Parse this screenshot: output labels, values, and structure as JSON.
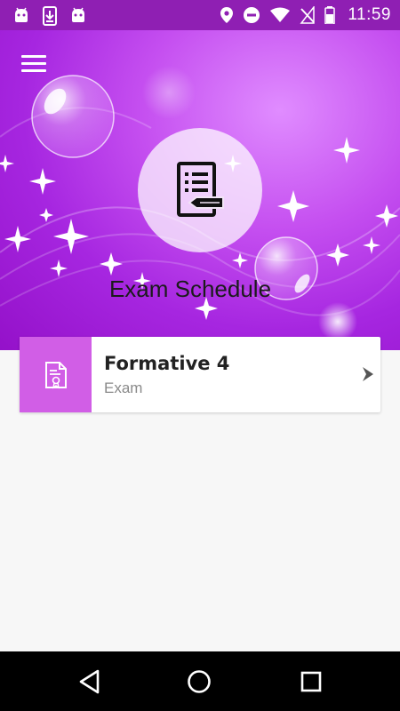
{
  "status_bar": {
    "time": "11:59",
    "left_icons": [
      "android-icon",
      "download-icon",
      "android-icon"
    ],
    "right_icons": [
      "location-icon",
      "do-not-disturb-icon",
      "wifi-icon",
      "no-sim-icon",
      "battery-icon"
    ]
  },
  "header": {
    "menu_icon": "hamburger-menu-icon",
    "logo_icon": "exam-document-icon",
    "title": "Exam Schedule"
  },
  "exams": [
    {
      "title": "Formative 4",
      "subtitle": "Exam",
      "icon": "certificate-document-icon",
      "action_icon": "chevron-right-icon"
    }
  ],
  "navigation": [
    "back-icon",
    "home-icon",
    "recents-icon"
  ],
  "colors": {
    "status_bar": "#8f1fb3",
    "header_purple": "#a626e0",
    "card_accent": "#d15ee6",
    "background": "#f7f7f7"
  }
}
